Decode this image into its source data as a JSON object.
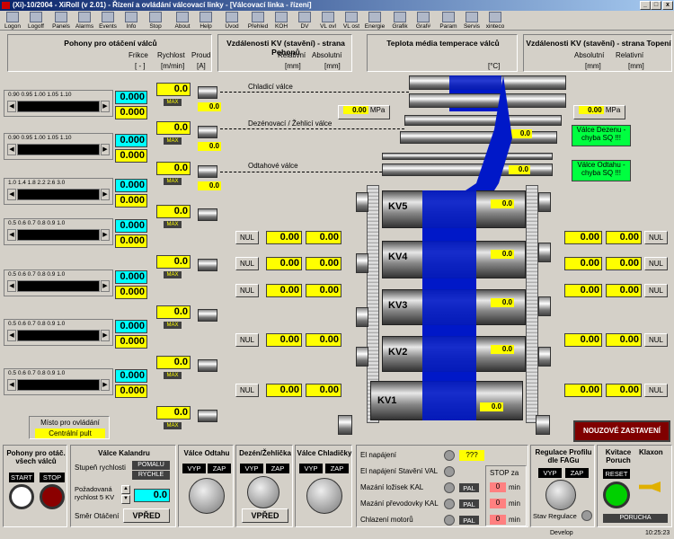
{
  "window": {
    "title": "(Xi)-10/2004 - XiRoll (v 2.01) - Řízení a ovládání válcovací linky - [Válcovací linka - řízení]"
  },
  "toolbar": [
    "Logon",
    "Logoff",
    "Panels",
    "Alarms",
    "Events",
    "Info",
    "Stop",
    "About",
    "Help",
    "Úvod",
    "Přehled",
    "KOH",
    "DV",
    "VL ovl",
    "VL ost",
    "Energie",
    "Grafik",
    "Graf#",
    "Param",
    "Servis",
    "xinteco"
  ],
  "headers": {
    "pohony": "Pohony pro otáčení válců",
    "frikce": "Frikce",
    "rychlost": "Rychlost",
    "proud": "Proud",
    "u_frikce": "[ - ]",
    "u_rychlost": "[m/min]",
    "u_proud": "[A]",
    "vzd_pohon": "Vzdálenosti KV (stavění) - strana Pohonů",
    "relativni": "Relativní",
    "absolutni": "Absolutní",
    "u_mm": "[mm]",
    "teplota": "Teplota média temperace válců",
    "u_c": "[°C]",
    "vzd_top": "Vzdálenosti KV (stavění) - strana Topení"
  },
  "scales": [
    "0.90  0.95  1.00  1.05  1.10",
    "0.90  0.95  1.00  1.05  1.10",
    "1.0   1.4   1.8   2.2   2.6   3.0",
    "0.5  0.6  0.7  0.8  0.9  1.0",
    "0.5  0.6  0.7  0.8  0.9  1.0",
    "0.5  0.6  0.7  0.8  0.9  1.0",
    "0.5  0.6  0.7  0.8  0.9  1.0"
  ],
  "v0000": "0.000",
  "v00": "0.00",
  "v0": "0.0",
  "max": "MAX",
  "nul": "NUL",
  "labels": {
    "chladici": "Chladicí válce",
    "dezenovaci": "Dezénovací / Žehlicí válce",
    "odtahove": "Odtahové válce"
  },
  "mpa": "MPa",
  "mpa_v": "0.00",
  "alarms": {
    "dezen": "Válce Dezenu - chyba SQ !!!",
    "odtah": "Válce Odtahu - chyba SQ !!!"
  },
  "kv": [
    "KV5",
    "KV4",
    "KV3",
    "KV2",
    "KV1"
  ],
  "nouzove": "NOUZOVÉ ZASTAVENÍ",
  "misto": {
    "title": "Místo pro ovládání",
    "value": "Centrální pult"
  },
  "bottom": {
    "pohony_otac": "Pohony pro otáč. všech válců",
    "start": "START",
    "stop": "STOP",
    "kalandr": "Válce Kalandru",
    "stupen": "Stupeň rychlosti",
    "pomalu": "POMALU",
    "rychle": "RYCHLE",
    "pozad": "Požadovaná rychlost 5 KV",
    "smer": "Směr Otáčení",
    "vpred": "VPŘED",
    "odtahu": "Válce Odtahu",
    "dezen": "Dezén/Žehlička",
    "chladicky": "Válce Chladičky",
    "vyp": "VYP",
    "zap": "ZAP",
    "el_nap": "El napájení",
    "el_nap_val": "El napájení Stavění VAL",
    "maz_loz": "Mazání ložisek KAL",
    "maz_prev": "Mazání převodovky KAL",
    "chl_mot": "Chlazení motorů",
    "qqq": "???",
    "pal": "PAL",
    "stop_za": "STOP za",
    "min": "min",
    "n0": "0",
    "regulace": "Regulace Profilu dle FAGu",
    "stav_reg": "Stav Regulace",
    "kvitace": "Kvitace Poruch",
    "klaxon": "Klaxon",
    "reset": "RESET",
    "porucha": "PORUCHA"
  },
  "status": {
    "develop": "Develop",
    "time": "10:25:23"
  }
}
